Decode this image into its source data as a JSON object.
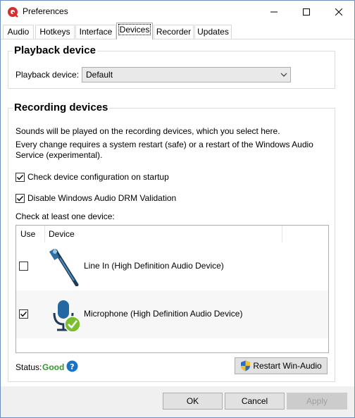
{
  "window": {
    "title": "Preferences",
    "icon": "app-logo-icon"
  },
  "tabs": [
    {
      "label": "Audio",
      "active": false
    },
    {
      "label": "Hotkeys",
      "active": false
    },
    {
      "label": "Interface",
      "active": false
    },
    {
      "label": "Devices",
      "active": true
    },
    {
      "label": "Recorder",
      "active": false
    },
    {
      "label": "Updates",
      "active": false
    }
  ],
  "playback": {
    "group_title": "Playback device",
    "label": "Playback device:",
    "selected": "Default"
  },
  "recording": {
    "group_title": "Recording devices",
    "info1": "Sounds will be played on the recording devices, which you select here.",
    "info2a": "Every change requires a system restart (safe) or a restart of the Windows Audio",
    "info2b": "Service (experimental).",
    "check_config": {
      "label": "Check device configuration on startup",
      "checked": true
    },
    "disable_drm": {
      "label": "Disable Windows Audio DRM Validation",
      "checked": true
    },
    "list_label": "Check at least one device:",
    "columns": {
      "use": "Use",
      "device": "Device"
    },
    "devices": [
      {
        "name": "Line In (High Definition Audio Device)",
        "checked": false,
        "icon": "line-in-jack-icon"
      },
      {
        "name": "Microphone (High Definition Audio Device)",
        "checked": true,
        "icon": "microphone-icon"
      }
    ],
    "status_label": "Status:",
    "status_value": "Good",
    "restart_label": "Restart Win-Audio"
  },
  "footer": {
    "ok": "OK",
    "cancel": "Cancel",
    "apply": "Apply"
  },
  "colors": {
    "status_good": "#2d9b27",
    "help_blue": "#1a73c7",
    "check_green": "#7bbf2e"
  }
}
